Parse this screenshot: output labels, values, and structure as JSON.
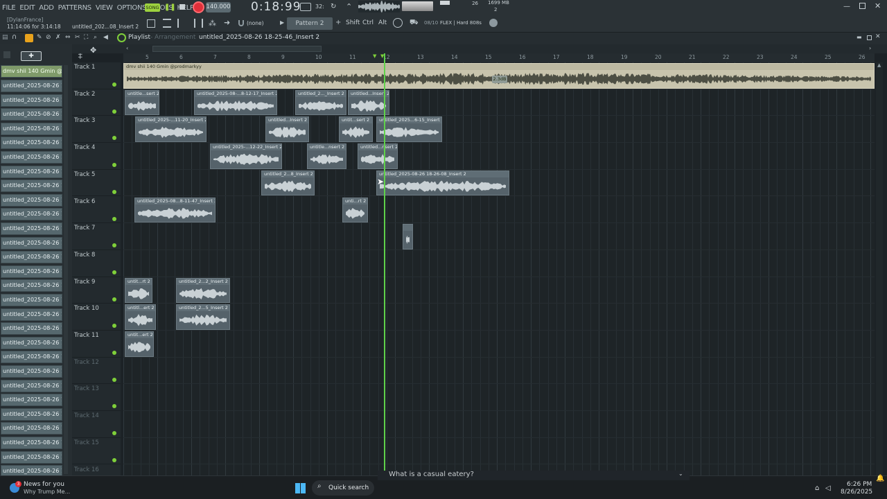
{
  "menu": [
    "FILE",
    "EDIT",
    "ADD",
    "PATTERNS",
    "VIEW",
    "OPTIONS",
    "TOOLS",
    "HELP"
  ],
  "transport": {
    "song_label": "SONG",
    "tempo": "140.000",
    "time": "0:18:99",
    "bars_label": "32:",
    "cpu_top": "26",
    "mem": "1699 MB",
    "mem_sub": "2"
  },
  "hint": {
    "user": "[DylanFrance]",
    "time": "11:14:06 for 3:14:18",
    "active_channel": "untitled_202...08_Insert 2"
  },
  "toolbar": {
    "snap_label": "(none)",
    "pattern_label": "Pattern 2",
    "shift": "Shift",
    "ctrl": "Ctrl",
    "alt": "Alt",
    "preset_counter": "08/10",
    "preset_name": "FLEX | Hard 808s"
  },
  "playlist": {
    "title": "Playlist",
    "subtitle": "Arrangement",
    "clip_name": "untitled_2025-08-26 18-25-46_Insert 2"
  },
  "browser": {
    "first": "dmv shii 140 Gmin @...",
    "items": [
      "untitled_2025-08-26 17-...",
      "untitled_2025-08-26 17-...",
      "untitled_2025-08-26 17-...",
      "untitled_2025-08-26 17-...",
      "untitled_2025-08-26 17-...",
      "untitled_2025-08-26 17-...",
      "untitled_2025-08-26 17-...",
      "untitled_2025-08-26 17-...",
      "untitled_2025-08-26 17-...",
      "untitled_2025-08-26 17-...",
      "untitled_2025-08-26 17-...",
      "untitled_2025-08-26 17-...",
      "untitled_2025-08-26 17-...",
      "untitled_2025-08-26 17-...",
      "untitled_2025-08-26 17-...",
      "untitled_2025-08-26 17-...",
      "untitled_2025-08-26 17-...",
      "untitled_2025-08-26 17-...",
      "untitled_2025-08-26 17-...",
      "untitled_2025-08-26 17-...",
      "untitled_2025-08-26 17-...",
      "untitled_2025-08-26 17-...",
      "untitled_2025-08-26 17-...",
      "untitled_2025-08-26 17-...",
      "untitled_2025-08-26 17-...",
      "untitled_2025-08-26 17-...",
      "untitled_2025-08-26 17-...",
      "untitled_2025-08-26 17-...",
      "untitled_2025-08-26 17-..."
    ]
  },
  "ruler": [
    "5",
    "6",
    "7",
    "8",
    "9",
    "10",
    "11",
    "12",
    "13",
    "14",
    "15",
    "16",
    "17",
    "18",
    "19",
    "20",
    "21",
    "22",
    "23",
    "24",
    "25",
    "26"
  ],
  "tracks": [
    "Track 1",
    "Track 2",
    "Track 3",
    "Track 4",
    "Track 5",
    "Track 6",
    "Track 7",
    "Track 8",
    "Track 9",
    "Track 10",
    "Track 11",
    "Track 12",
    "Track 13",
    "Track 14",
    "Track 15",
    "Track 16"
  ],
  "clips": [
    {
      "track": 0,
      "start": 0,
      "end": 1084,
      "title": "dmv shii 140 Gmin @prodmarkyy",
      "kind": "master"
    },
    {
      "track": 1,
      "start": 2,
      "end": 52,
      "title": "untitle...sert 2"
    },
    {
      "track": 1,
      "start": 102,
      "end": 222,
      "title": "untitled_2025-08-...8-12-17_Insert 2"
    },
    {
      "track": 1,
      "start": 248,
      "end": 322,
      "title": "untitled_2..._Insert 2"
    },
    {
      "track": 1,
      "start": 324,
      "end": 384,
      "title": "untitled...Insert 2"
    },
    {
      "track": 2,
      "start": 17,
      "end": 120,
      "title": "untitled_2025-...11-20_Insert 2"
    },
    {
      "track": 2,
      "start": 205,
      "end": 268,
      "title": "untitled...Insert 2"
    },
    {
      "track": 2,
      "start": 311,
      "end": 360,
      "title": "untit...sert 2"
    },
    {
      "track": 2,
      "start": 365,
      "end": 460,
      "title": "untitled_2025...6-15_Insert 2"
    },
    {
      "track": 3,
      "start": 125,
      "end": 229,
      "title": "untitled_2025-...12-22_Insert 2"
    },
    {
      "track": 3,
      "start": 265,
      "end": 322,
      "title": "untitle...nsert 2"
    },
    {
      "track": 3,
      "start": 338,
      "end": 396,
      "title": "untitled...nsert 2"
    },
    {
      "track": 4,
      "start": 199,
      "end": 276,
      "title": "untitled_2...8_Insert 2"
    },
    {
      "track": 4,
      "start": 365,
      "end": 557,
      "title": "untitled_2025-08-26 18-26-08_Insert 2"
    },
    {
      "track": 5,
      "start": 16,
      "end": 133,
      "title": "untitled_2025-08...8-11-47_Insert 2"
    },
    {
      "track": 5,
      "start": 316,
      "end": 353,
      "title": "unti...rt 2"
    },
    {
      "track": 6,
      "start": 403,
      "end": 418,
      "title": ""
    },
    {
      "track": 8,
      "start": 2,
      "end": 42,
      "title": "untit...rt 2"
    },
    {
      "track": 8,
      "start": 76,
      "end": 154,
      "title": "untitled_2...2_Insert 2"
    },
    {
      "track": 9,
      "start": 2,
      "end": 47,
      "title": "untitl...ert 2"
    },
    {
      "track": 9,
      "start": 76,
      "end": 154,
      "title": "untitled_2...5_Insert 2"
    },
    {
      "track": 10,
      "start": 2,
      "end": 44,
      "title": "untit...ert 2"
    }
  ],
  "volume_badge": "2.3dB",
  "taskbar": {
    "news_title": "News for you",
    "news_sub": "Why Trump Me...",
    "search": "Quick search",
    "search_query": "What is a casual eatery?",
    "clock_time": "6:26 PM",
    "clock_date": "8/26/2025",
    "notif_count": "3"
  },
  "colors": {
    "accent_green": "#5fd24a",
    "record_red": "#e0303a",
    "clip_bg": "#55626a",
    "master_clip": "#c8c4ad"
  }
}
